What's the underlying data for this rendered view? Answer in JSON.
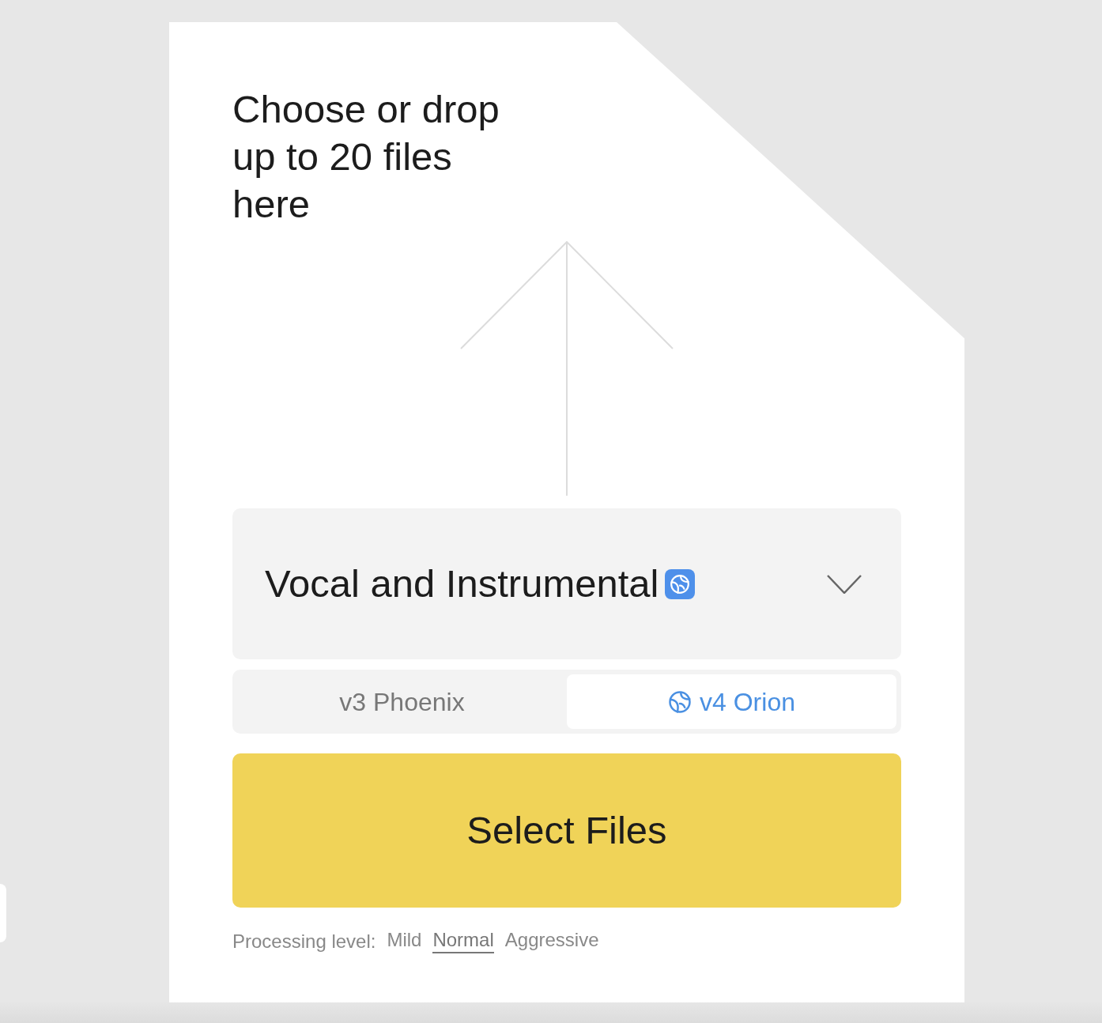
{
  "upload": {
    "heading": "Choose or drop up to 20 files here"
  },
  "separation": {
    "value": "Vocal and Instrumental"
  },
  "versions": [
    {
      "label": "v3 Phoenix",
      "selected": false,
      "badge": false
    },
    {
      "label": "v4 Orion",
      "selected": true,
      "badge": true
    }
  ],
  "select_button": "Select Files",
  "processing": {
    "label": "Processing level:",
    "levels": [
      {
        "label": "Mild",
        "selected": false
      },
      {
        "label": "Normal",
        "selected": true
      },
      {
        "label": "Aggressive",
        "selected": false
      }
    ]
  }
}
